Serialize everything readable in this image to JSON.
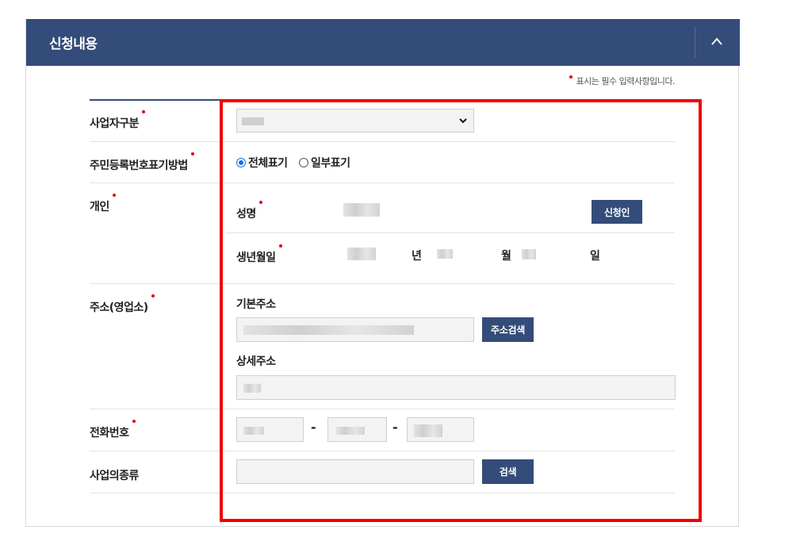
{
  "section": {
    "title": "신청내용",
    "required_note": "표시는 필수 입력사항입니다."
  },
  "fields": {
    "business_type": {
      "label": "사업자구분",
      "value": ""
    },
    "rrn_display": {
      "label": "주민등록번호표기방법",
      "options": [
        {
          "label": "전체표기",
          "selected": true
        },
        {
          "label": "일부표기",
          "selected": false
        }
      ]
    },
    "individual": {
      "label": "개인",
      "name_label": "성명",
      "applicant_button": "신청인",
      "birth_label": "생년월일",
      "year_unit": "년",
      "month_unit": "월",
      "day_unit": "일"
    },
    "address": {
      "label": "주소(영업소)",
      "basic_label": "기본주소",
      "search_button": "주소검색",
      "detail_label": "상세주소"
    },
    "phone": {
      "label": "전화번호",
      "separator": "-"
    },
    "business_kind": {
      "label": "사업의종류",
      "search_button": "검색"
    }
  },
  "colors": {
    "header_bg": "#344c79",
    "button_bg": "#344c79",
    "required_dot": "#e60012",
    "highlight_border": "#ee0000"
  }
}
